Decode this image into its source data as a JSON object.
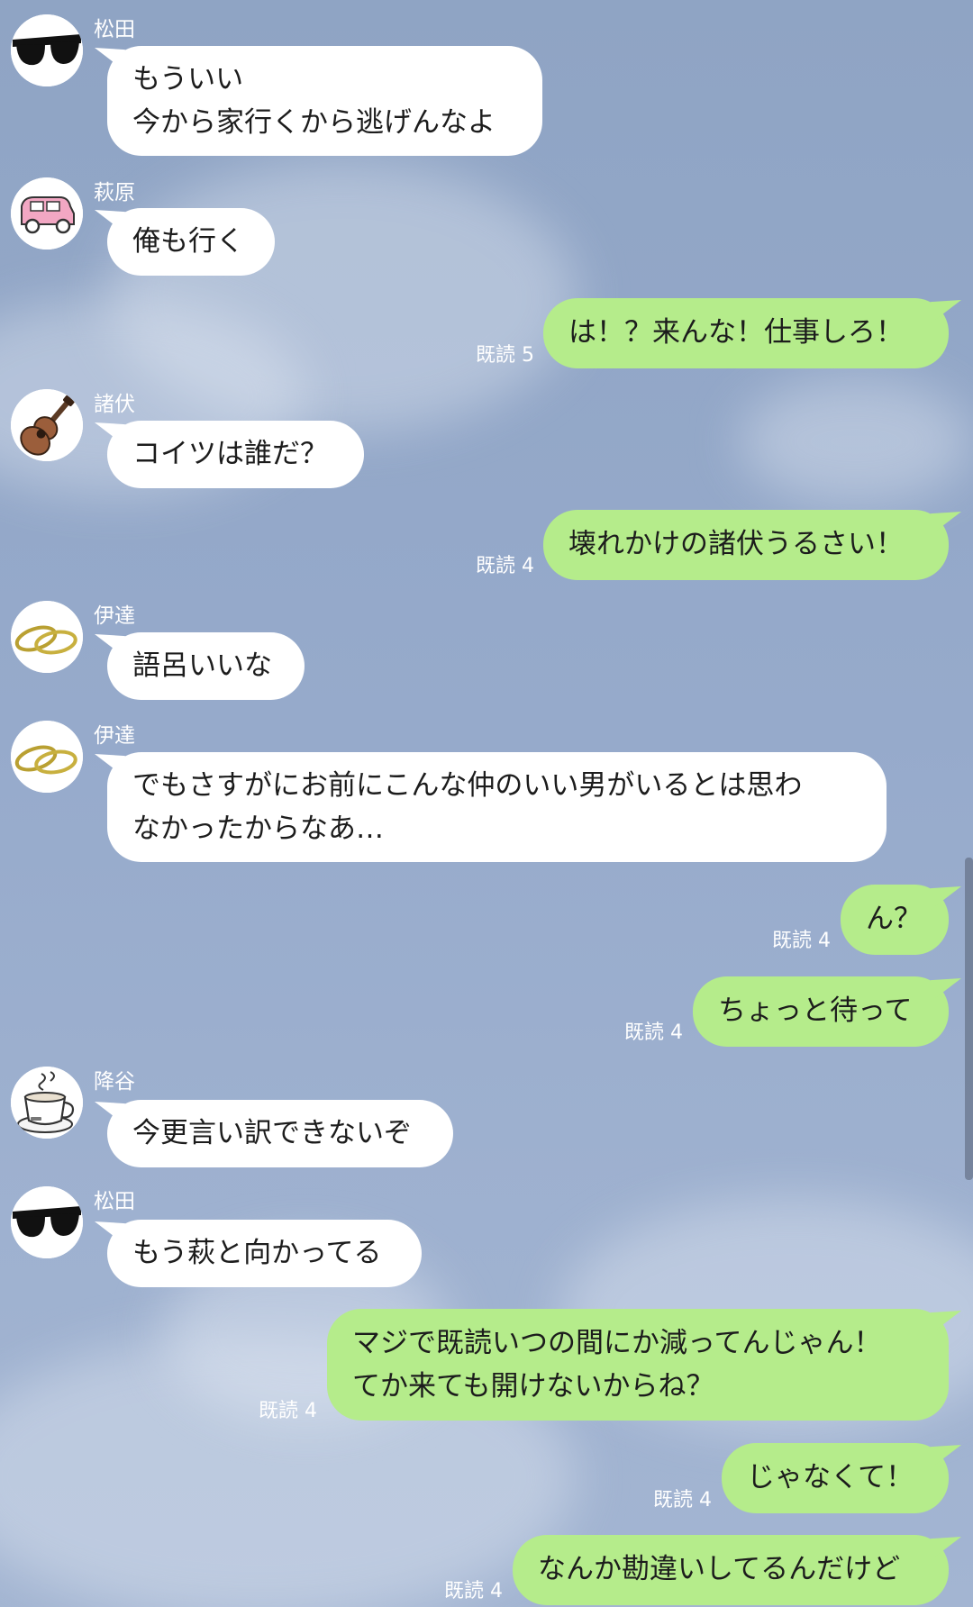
{
  "chat": {
    "read_prefix": "既読",
    "messages": [
      {
        "side": "in",
        "sender": "松田",
        "avatar": "sunglasses-icon",
        "lines": [
          "もういい",
          "今から家行くから逃げんなよ"
        ]
      },
      {
        "side": "in",
        "sender": "萩原",
        "avatar": "pink-car-icon",
        "lines": [
          "俺も行く"
        ]
      },
      {
        "side": "out",
        "read": "既読 5",
        "lines": [
          "は！？来んな！仕事しろ！"
        ]
      },
      {
        "side": "in",
        "sender": "諸伏",
        "avatar": "guitar-icon",
        "lines": [
          "コイツは誰だ？"
        ]
      },
      {
        "side": "out",
        "read": "既読 4",
        "lines": [
          "壊れかけの諸伏うるさい！"
        ]
      },
      {
        "side": "in",
        "sender": "伊達",
        "avatar": "rings-icon",
        "lines": [
          "語呂いいな"
        ]
      },
      {
        "side": "in",
        "sender": "伊達",
        "avatar": "rings-icon",
        "lines": [
          "でもさすがにお前にこんな仲のいい男がいるとは思わ",
          "なかったからなあ…"
        ]
      },
      {
        "side": "out",
        "read": "既読 4",
        "lines": [
          "ん？"
        ]
      },
      {
        "side": "out",
        "read": "既読 4",
        "lines": [
          "ちょっと待って"
        ]
      },
      {
        "side": "in",
        "sender": "降谷",
        "avatar": "coffee-cup-icon",
        "lines": [
          "今更言い訳できないぞ"
        ]
      },
      {
        "side": "in",
        "sender": "松田",
        "avatar": "sunglasses-icon",
        "lines": [
          "もう萩と向かってる"
        ]
      },
      {
        "side": "out",
        "read": "既読 4",
        "lines": [
          "マジで既読いつの間にか減ってんじゃん！",
          "てか来ても開けないからね？"
        ]
      },
      {
        "side": "out",
        "read": "既読 4",
        "lines": [
          "じゃなくて！"
        ]
      },
      {
        "side": "out",
        "read": "既読 4",
        "lines": [
          "なんか勘違いしてるんだけど"
        ]
      }
    ]
  },
  "colors": {
    "background": "#94a8c8",
    "incoming_bubble": "#ffffff",
    "outgoing_bubble": "#b5ec8b",
    "meta_text": "#ffffff"
  }
}
